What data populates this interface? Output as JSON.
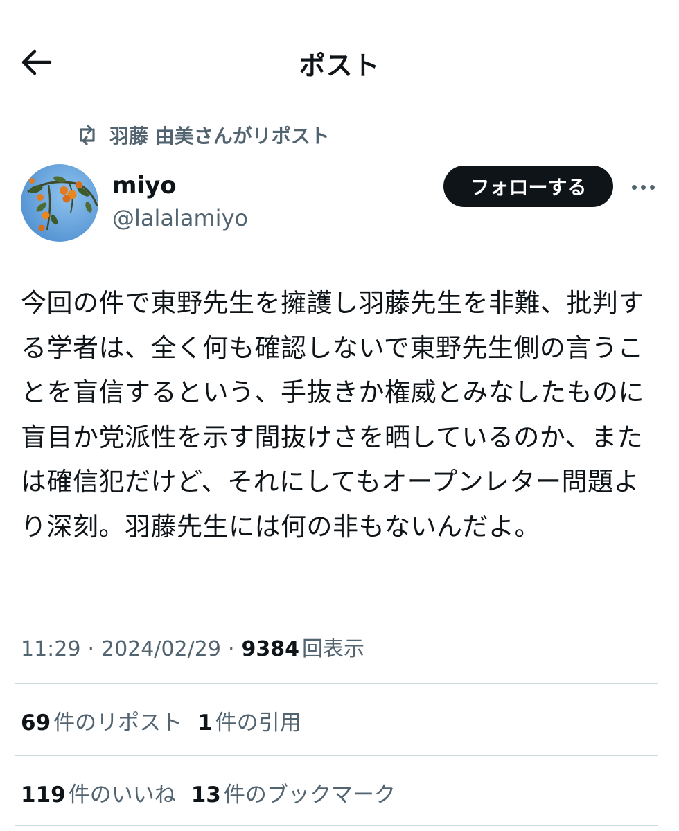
{
  "header": {
    "title": "ポスト",
    "back_icon": "arrow-left-icon"
  },
  "repost_context": {
    "icon": "repost-icon",
    "text": "羽藤 由美さんがリポスト"
  },
  "author": {
    "display_name": "miyo",
    "handle": "@lalalamiyo",
    "avatar": "persimmon-tree-photo"
  },
  "actions": {
    "follow_label": "フォローする",
    "more_icon": "more-horizontal-icon"
  },
  "post": {
    "text": "今回の件で東野先生を擁護し羽藤先生を非難、批判する学者は、全く何も確認しないで東野先生側の言うことを盲信するという、手抜きか権威とみなしたものに盲目か党派性を示す間抜けさを晒しているのか、または確信犯だけど、それにしてもオープンレター問題より深刻。羽藤先生には何の非もないんだよ。"
  },
  "meta": {
    "time": "11:29",
    "separator": "·",
    "date": "2024/02/29",
    "views_count": "9384",
    "views_label": "回表示"
  },
  "stats": {
    "reposts_count": "69",
    "reposts_label": "件のリポスト",
    "quotes_count": "1",
    "quotes_label": "件の引用",
    "likes_count": "119",
    "likes_label": "件のいいね",
    "bookmarks_count": "13",
    "bookmarks_label": "件のブックマーク"
  },
  "colors": {
    "text": "#0f1419",
    "secondary": "#536471",
    "divider": "#cfd9de",
    "button_bg": "#0f1419"
  }
}
